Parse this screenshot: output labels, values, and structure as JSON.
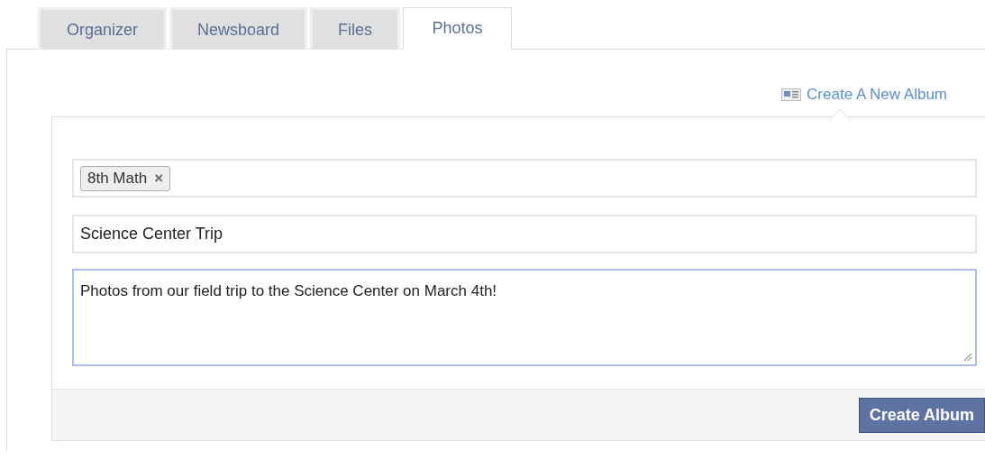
{
  "tabs": [
    {
      "label": "Organizer",
      "selected": false
    },
    {
      "label": "Newsboard",
      "selected": false
    },
    {
      "label": "Files",
      "selected": false
    },
    {
      "label": "Photos",
      "selected": true
    }
  ],
  "create_link": "Create A New Album",
  "form": {
    "tags": [
      {
        "label": "8th Math",
        "remove": "×"
      }
    ],
    "title_value": "Science Center Trip",
    "description_value": "Photos from our field trip to the Science Center on March 4th!",
    "description_focused": true
  },
  "submit_button": "Create Album"
}
